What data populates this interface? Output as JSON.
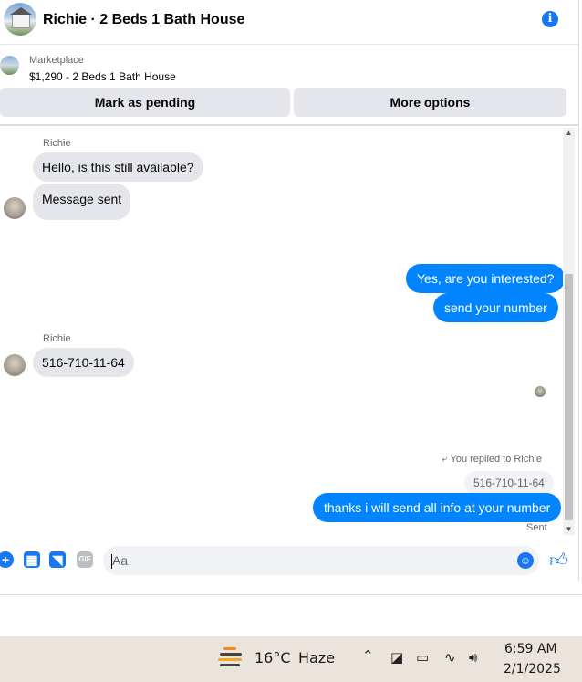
{
  "header": {
    "title": "Richie · 2 Beds 1 Bath House",
    "info_icon": "info-icon"
  },
  "marketplace": {
    "label": "Marketplace",
    "listing": "$1,290 - 2 Beds 1 Bath House"
  },
  "actions": {
    "mark_pending": "Mark as pending",
    "more_options": "More options"
  },
  "messages": [
    {
      "from": "Richie",
      "sender_label": "Richie",
      "text": "Hello, is this still available?"
    },
    {
      "from": "Richie",
      "text": "Message sent"
    },
    {
      "from": "me",
      "text": "Yes, are you interested?"
    },
    {
      "from": "me",
      "text": "send your number"
    },
    {
      "from": "Richie",
      "sender_label": "Richie",
      "text": "516-710-11-64"
    },
    {
      "from": "me",
      "replied_label": "You replied to Richie",
      "quoted": "516-710-11-64",
      "text": "thanks i will send all info at your number",
      "status": "Sent"
    }
  ],
  "composer": {
    "placeholder": "Aa",
    "gif_label": "GIF",
    "icons": [
      "plus-icon",
      "image-icon",
      "sticker-icon",
      "gif-icon",
      "emoji-icon",
      "like-icon"
    ]
  },
  "taskbar": {
    "temperature": "16°C",
    "weather": "Haze",
    "time": "6:59 AM",
    "date": "2/1/2025",
    "tray_icons": [
      "chevron-up-icon",
      "meet-icon",
      "battery-icon",
      "wifi-icon",
      "volume-icon"
    ]
  },
  "colors": {
    "accent": "#0084ff",
    "brand_blue": "#1877f2",
    "incoming_bubble": "#e4e6eb",
    "taskbar_bg": "#eae4dc"
  }
}
